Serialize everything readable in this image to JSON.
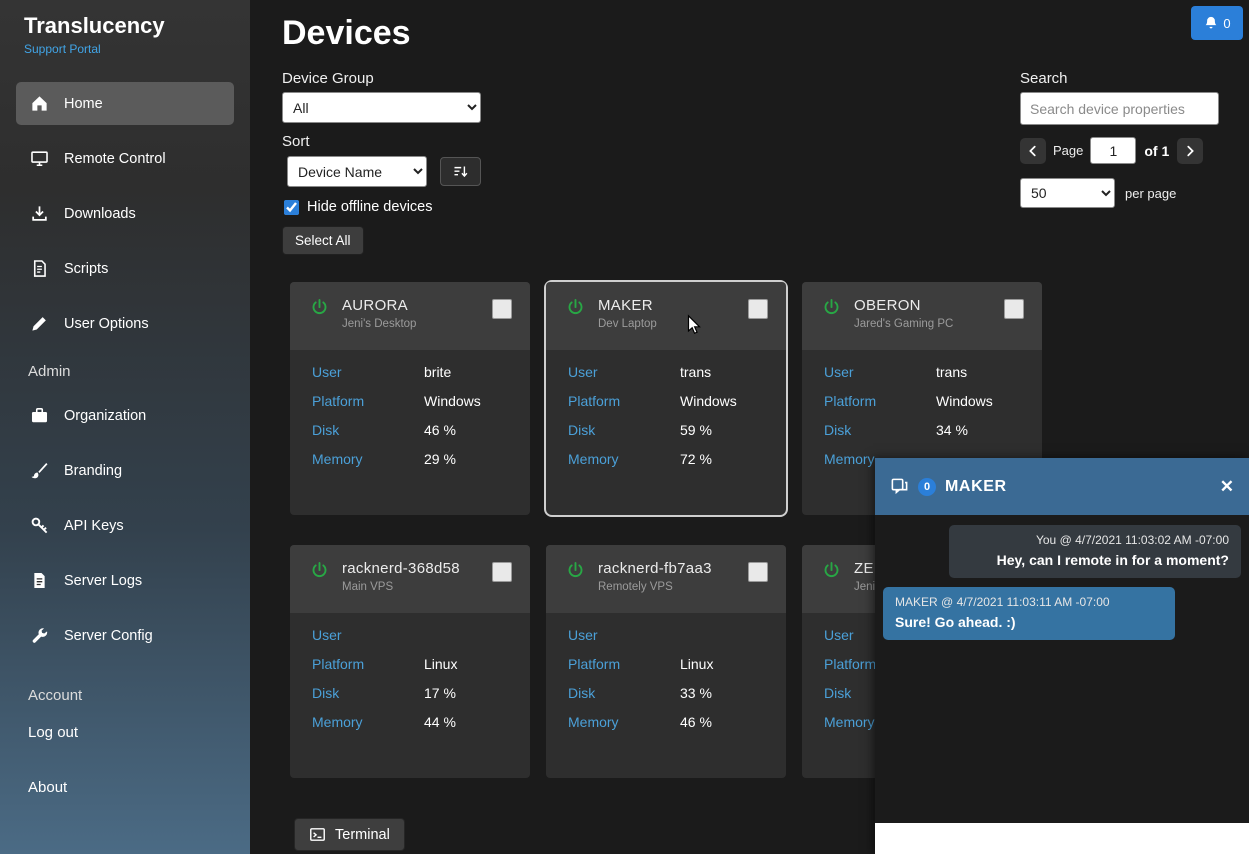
{
  "app": {
    "title": "Translucency",
    "subtitle": "Support Portal"
  },
  "sidebar": {
    "items": [
      {
        "label": "Home"
      },
      {
        "label": "Remote Control"
      },
      {
        "label": "Downloads"
      },
      {
        "label": "Scripts"
      },
      {
        "label": "User Options"
      }
    ],
    "admin_label": "Admin",
    "admin_items": [
      {
        "label": "Organization"
      },
      {
        "label": "Branding"
      },
      {
        "label": "API Keys"
      },
      {
        "label": "Server Logs"
      },
      {
        "label": "Server Config"
      }
    ],
    "account_label": "Account",
    "logout_label": "Log out",
    "about_label": "About"
  },
  "header": {
    "title": "Devices",
    "notification_count": "0"
  },
  "filters": {
    "device_group_label": "Device Group",
    "device_group_value": "All",
    "sort_label": "Sort",
    "sort_value": "Device Name",
    "hide_offline_label": "Hide offline devices",
    "hide_offline_checked": true,
    "select_all_label": "Select All"
  },
  "search": {
    "label": "Search",
    "placeholder": "Search device properties"
  },
  "pagination": {
    "page_label": "Page",
    "page_value": "1",
    "of_label": "of 1",
    "per_page_value": "50",
    "per_page_label": "per page"
  },
  "device_fields": [
    "User",
    "Platform",
    "Disk",
    "Memory"
  ],
  "devices": [
    {
      "name": "AURORA",
      "alias": "Jeni's Desktop",
      "user": "brite",
      "platform": "Windows",
      "disk": "46 %",
      "memory": "29 %"
    },
    {
      "name": "MAKER",
      "alias": "Dev Laptop",
      "user": "trans",
      "platform": "Windows",
      "disk": "59 %",
      "memory": "72 %"
    },
    {
      "name": "OBERON",
      "alias": "Jared's Gaming PC",
      "user": "trans",
      "platform": "Windows",
      "disk": "34 %",
      "memory": ""
    },
    {
      "name": "racknerd-368d58",
      "alias": "Main VPS",
      "user": "",
      "platform": "Linux",
      "disk": "17 %",
      "memory": "44 %"
    },
    {
      "name": "racknerd-fb7aa3",
      "alias": "Remotely VPS",
      "user": "",
      "platform": "Linux",
      "disk": "33 %",
      "memory": "46 %"
    },
    {
      "name": "ZEN",
      "alias": "Jeni's",
      "user": "",
      "platform": "",
      "disk": "",
      "memory": ""
    }
  ],
  "chat": {
    "title": "MAKER",
    "badge": "0",
    "close_glyph": "✕",
    "separator": "@",
    "messages": [
      {
        "sender": "You",
        "timestamp": "4/7/2021 11:03:02 AM -07:00",
        "text": "Hey, can I remote in for a moment?"
      },
      {
        "sender": "MAKER",
        "timestamp": "4/7/2021 11:03:11 AM -07:00",
        "text": "Sure! Go ahead. :)"
      }
    ]
  },
  "terminal": {
    "label": "Terminal"
  },
  "colors": {
    "accent_blue": "#2b7fd9",
    "label_blue": "#4ba0d8",
    "power_green": "#28a745",
    "chat_header": "#3b6a94",
    "chat_bubble_left": "#3573a2",
    "chat_bubble_right": "#343a40"
  }
}
